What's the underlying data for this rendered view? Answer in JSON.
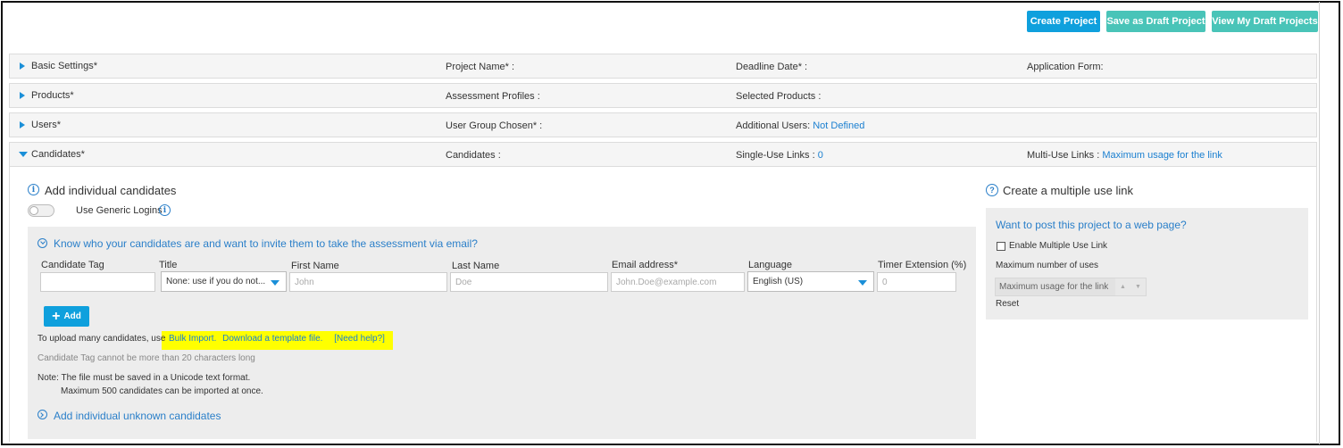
{
  "toolbar": {
    "create_label": "Create Project",
    "draft_label": "Save as Draft Project",
    "view_drafts_label": "View My Draft Projects"
  },
  "sections": {
    "basic": {
      "label": "Basic Settings*",
      "f1": "Project Name* :",
      "f2": "Deadline Date* :",
      "f3": "Application Form:"
    },
    "products": {
      "label": "Products*",
      "f1": "Assessment Profiles :",
      "f2": "Selected Products :"
    },
    "users": {
      "label": "Users*",
      "f1": "User Group Chosen* :",
      "f2": "Additional Users:",
      "f2_value": "Not Defined"
    },
    "candidates": {
      "label": "Candidates*",
      "f1": "Candidates :",
      "f2": "Single-Use Links :",
      "f2_value": "0",
      "f3": "Multi-Use Links :",
      "f3_value": "Maximum usage for the link"
    }
  },
  "individual": {
    "title": "Add individual candidates",
    "generic_logins": "Use Generic Logins",
    "invite_heading": "Know who your candidates are and want to invite them to take the assessment via email?",
    "columns": {
      "tag": "Candidate Tag",
      "title": "Title",
      "first": "First Name",
      "last": "Last Name",
      "email": "Email address*",
      "language": "Language",
      "timer": "Timer Extension (%)"
    },
    "inputs": {
      "tag_value": "",
      "title_selected": "None: use if you do not...",
      "first_placeholder": "John",
      "last_placeholder": "Doe",
      "email_placeholder": "John.Doe@example.com",
      "language_selected": "English (US)",
      "timer_placeholder": "0"
    },
    "add_label": "Add",
    "upload_prefix": "To upload many candidates, use",
    "bulk_import": "Bulk Import.",
    "download_template": "Download a template file.",
    "need_help": "[Need help?]",
    "tag_limit": "Candidate Tag cannot be more than 20 characters long",
    "note_line1": "Note: The file must be saved in a Unicode text format.",
    "note_line2": "Maximum 500 candidates can be imported at once.",
    "unknown_heading": "Add individual unknown candidates"
  },
  "multiple_link": {
    "title": "Create a multiple use link",
    "question": "Want to post this project to a web page?",
    "enable_label": "Enable Multiple Use Link",
    "max_label": "Maximum number of uses",
    "max_placeholder": "Maximum usage for the link",
    "reset_label": "Reset"
  }
}
